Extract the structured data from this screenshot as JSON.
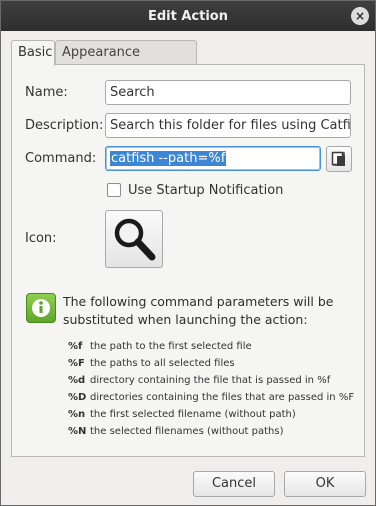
{
  "window": {
    "title": "Edit Action",
    "close_glyph": "×"
  },
  "tabs": [
    {
      "label": "Basic",
      "active": true
    },
    {
      "label": "Appearance Conditions",
      "active": false
    }
  ],
  "form": {
    "name_label": "Name:",
    "name_value": "Search",
    "description_label": "Description:",
    "description_value": "Search this folder for files using Catfish",
    "command_label": "Command:",
    "command_value": "catfish --path=%f",
    "startup_notification_label": "Use Startup Notification",
    "startup_notification_checked": false,
    "icon_label": "Icon:",
    "icon_name": "search-icon"
  },
  "info": {
    "icon": "info-icon",
    "text": "The following command parameters will be substituted when launching the action:"
  },
  "parameters": [
    {
      "code": "%f",
      "desc": "the path to the first selected file"
    },
    {
      "code": "%F",
      "desc": "the paths to all selected files"
    },
    {
      "code": "%d",
      "desc": "directory containing the file that is passed in %f"
    },
    {
      "code": "%D",
      "desc": "directories containing the files that are passed in %F"
    },
    {
      "code": "%n",
      "desc": "the first selected filename (without path)"
    },
    {
      "code": "%N",
      "desc": "the selected filenames (without paths)"
    }
  ],
  "buttons": {
    "cancel": "Cancel",
    "ok": "OK"
  }
}
